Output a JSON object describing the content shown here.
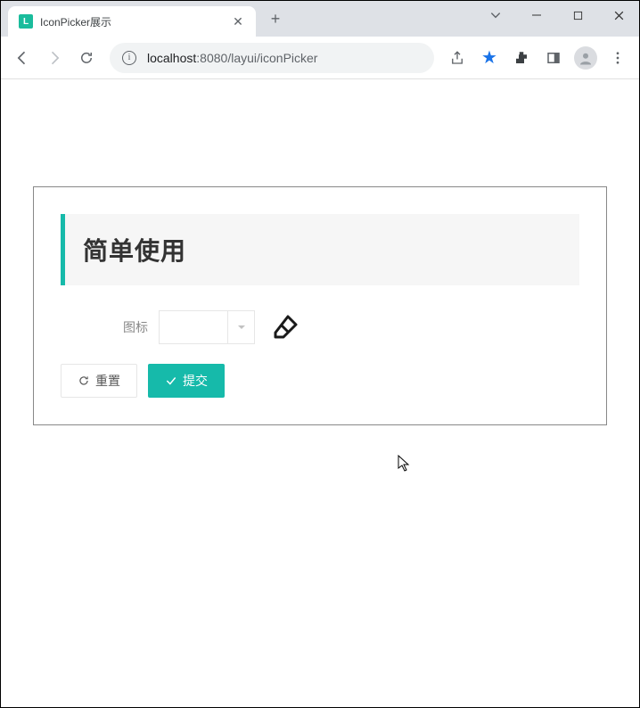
{
  "browser": {
    "tab_title": "IconPicker展示",
    "url_host": "localhost",
    "url_port": ":8080",
    "url_path": "/layui/iconPicker"
  },
  "page": {
    "heading": "简单使用",
    "icon_label": "图标",
    "reset_label": "重置",
    "submit_label": "提交"
  }
}
